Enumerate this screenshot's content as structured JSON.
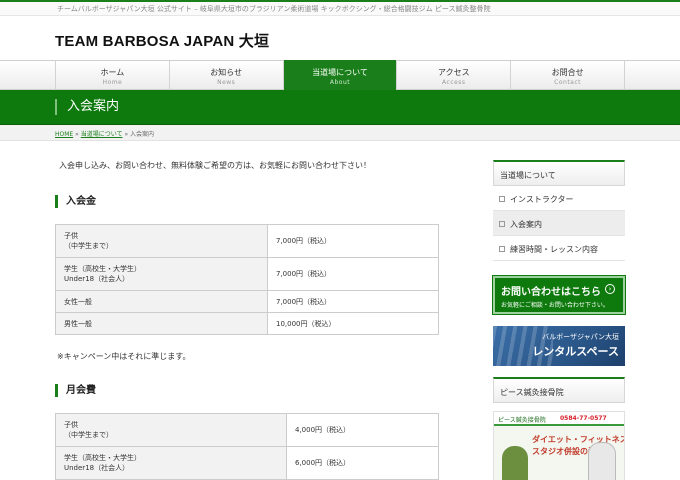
{
  "topbar": {
    "text": "チームバルボーザジャパン大垣 公式サイト – 岐阜県大垣市のブラジリアン柔術道場 キックボクシング・総合格闘技ジム ピース鍼灸整骨院"
  },
  "site": {
    "logo": "TEAM BARBOSA JAPAN 大垣"
  },
  "nav": {
    "items": [
      {
        "jp": "ホーム",
        "en": "Home"
      },
      {
        "jp": "お知らせ",
        "en": "News"
      },
      {
        "jp": "当道場について",
        "en": "About"
      },
      {
        "jp": "アクセス",
        "en": "Access"
      },
      {
        "jp": "お問合せ",
        "en": "Contact"
      }
    ],
    "active_index": 2
  },
  "page": {
    "title": "入会案内"
  },
  "breadcrumb": {
    "home": "HOME",
    "sep1": " » ",
    "parent": "当道場について",
    "sep2": " » ",
    "current": "入会案内"
  },
  "main": {
    "intro": "入会申し込み、お問い合わせ、無料体験ご希望の方は、お気軽にお問い合わせ下さい！",
    "section1": {
      "heading": "入会金",
      "rows": [
        {
          "label_line1": "子供",
          "label_line2": "（中学生まで）",
          "value": "7,000円（税込）"
        },
        {
          "label_line1": "学生（高校生・大学生）",
          "label_line2": "Under18（社会人）",
          "value": "7,000円（税込）"
        },
        {
          "label_line1": "女性一般",
          "label_line2": "",
          "value": "7,000円（税込）"
        },
        {
          "label_line1": "男性一般",
          "label_line2": "",
          "value": "10,000円（税込）"
        }
      ],
      "note": "※キャンペーン中はそれに準じます。"
    },
    "section2": {
      "heading": "月会費",
      "rows": [
        {
          "label_line1": "子供",
          "label_line2": "（中学生まで）",
          "value": "4,000円（税込）"
        },
        {
          "label_line1": "学生（高校生・大学生）",
          "label_line2": "Under18（社会人）",
          "value": "6,000円（税込）"
        }
      ]
    }
  },
  "sidebar": {
    "heading": "当道場について",
    "items": [
      "インストラクター",
      "入会案内",
      "練習時間・レッスン内容"
    ],
    "current_index": 1,
    "cta": {
      "title": "お問い合わせはこちら",
      "subtitle": "お気軽にご相談・お問い合わせ下さい。",
      "arrow": "›"
    },
    "rental": {
      "line1": "バルボーザジャパン大垣",
      "line2": "レンタルスペース"
    },
    "heading2": "ピース鍼灸接骨院",
    "ad": {
      "clinic": "ピース鍼灸接骨院",
      "phone": "0584-77-0577",
      "line1": "ダイエット・フィットネス",
      "line2": "スタジオ併設の治療院"
    }
  },
  "colors": {
    "brand_green": "#0e7a0e",
    "accent_green": "#1a7f1a",
    "table_label_bg": "#f2f2f2"
  }
}
